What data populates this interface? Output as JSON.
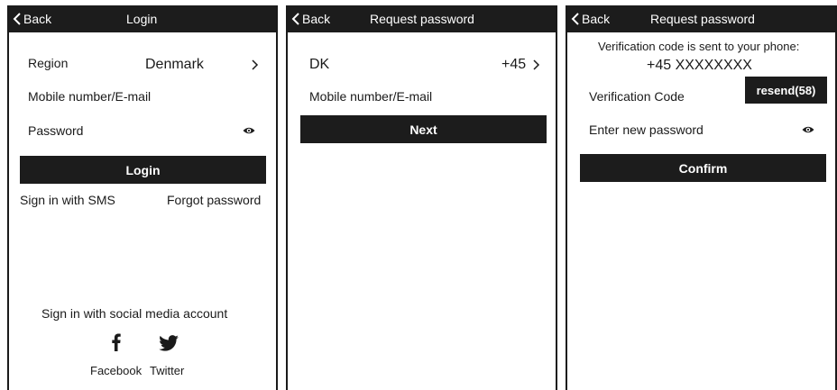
{
  "screens": [
    {
      "back_label": "Back",
      "title": "Login",
      "region": {
        "label": "Region",
        "value": "Denmark",
        "chevron_icon": "chevron-right-icon"
      },
      "account_field": {
        "placeholder": "Mobile number/E-mail"
      },
      "password_field": {
        "placeholder": "Password",
        "toggle_icon": "eye-icon"
      },
      "login_button": "Login",
      "sms_link": "Sign in with SMS",
      "forgot_link": "Forgot password",
      "social_heading": "Sign in with social media account",
      "social": [
        {
          "label": "Facebook",
          "icon": "facebook-icon"
        },
        {
          "label": "Twitter",
          "icon": "twitter-icon"
        }
      ]
    },
    {
      "back_label": "Back",
      "title": "Request password",
      "country": {
        "code": "DK",
        "dial": "+45",
        "chevron_icon": "chevron-right-icon"
      },
      "account_field": {
        "placeholder": "Mobile number/E-mail"
      },
      "next_button": "Next"
    },
    {
      "back_label": "Back",
      "title": "Request password",
      "sent_message": "Verification code is sent to your phone:",
      "phone_masked": "+45 XXXXXXXX",
      "code_field": {
        "placeholder": "Verification Code"
      },
      "resend_button": "resend(58)",
      "new_password_field": {
        "placeholder": "Enter new password",
        "toggle_icon": "eye-icon"
      },
      "confirm_button": "Confirm"
    }
  ],
  "colors": {
    "bar": "#1c1c1c",
    "text": "#1a1a1a",
    "background": "#ffffff"
  }
}
